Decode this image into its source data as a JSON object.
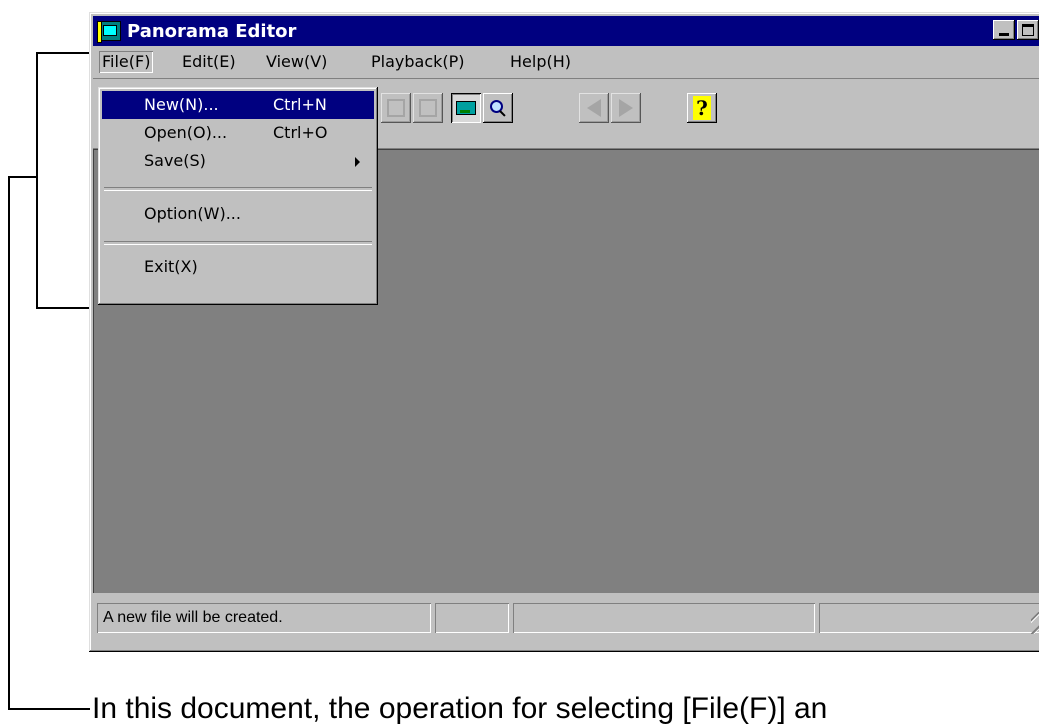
{
  "window": {
    "title": "Panorama Editor",
    "controls": {
      "minimize": "_",
      "maximize": "□",
      "close": "×"
    }
  },
  "menubar": {
    "file": "File(F)",
    "edit": "Edit(E)",
    "view": "View(V)",
    "playback": "Playback(P)",
    "help": "Help(H)"
  },
  "file_menu": {
    "new": {
      "label": "New(N)...",
      "shortcut": "Ctrl+N"
    },
    "open": {
      "label": "Open(O)...",
      "shortcut": "Ctrl+O"
    },
    "save": {
      "label": "Save(S)"
    },
    "option": {
      "label": "Option(W)..."
    },
    "exit": {
      "label": "Exit(X)"
    }
  },
  "toolbar": {
    "help_glyph": "?"
  },
  "statusbar": {
    "message": "A new file will be created."
  },
  "caption": "In this document, the operation for selecting [File(F)] an",
  "colors": {
    "titlebar": "#000080",
    "highlight": "#000080",
    "client": "#808080",
    "face": "#c0c0c0"
  }
}
